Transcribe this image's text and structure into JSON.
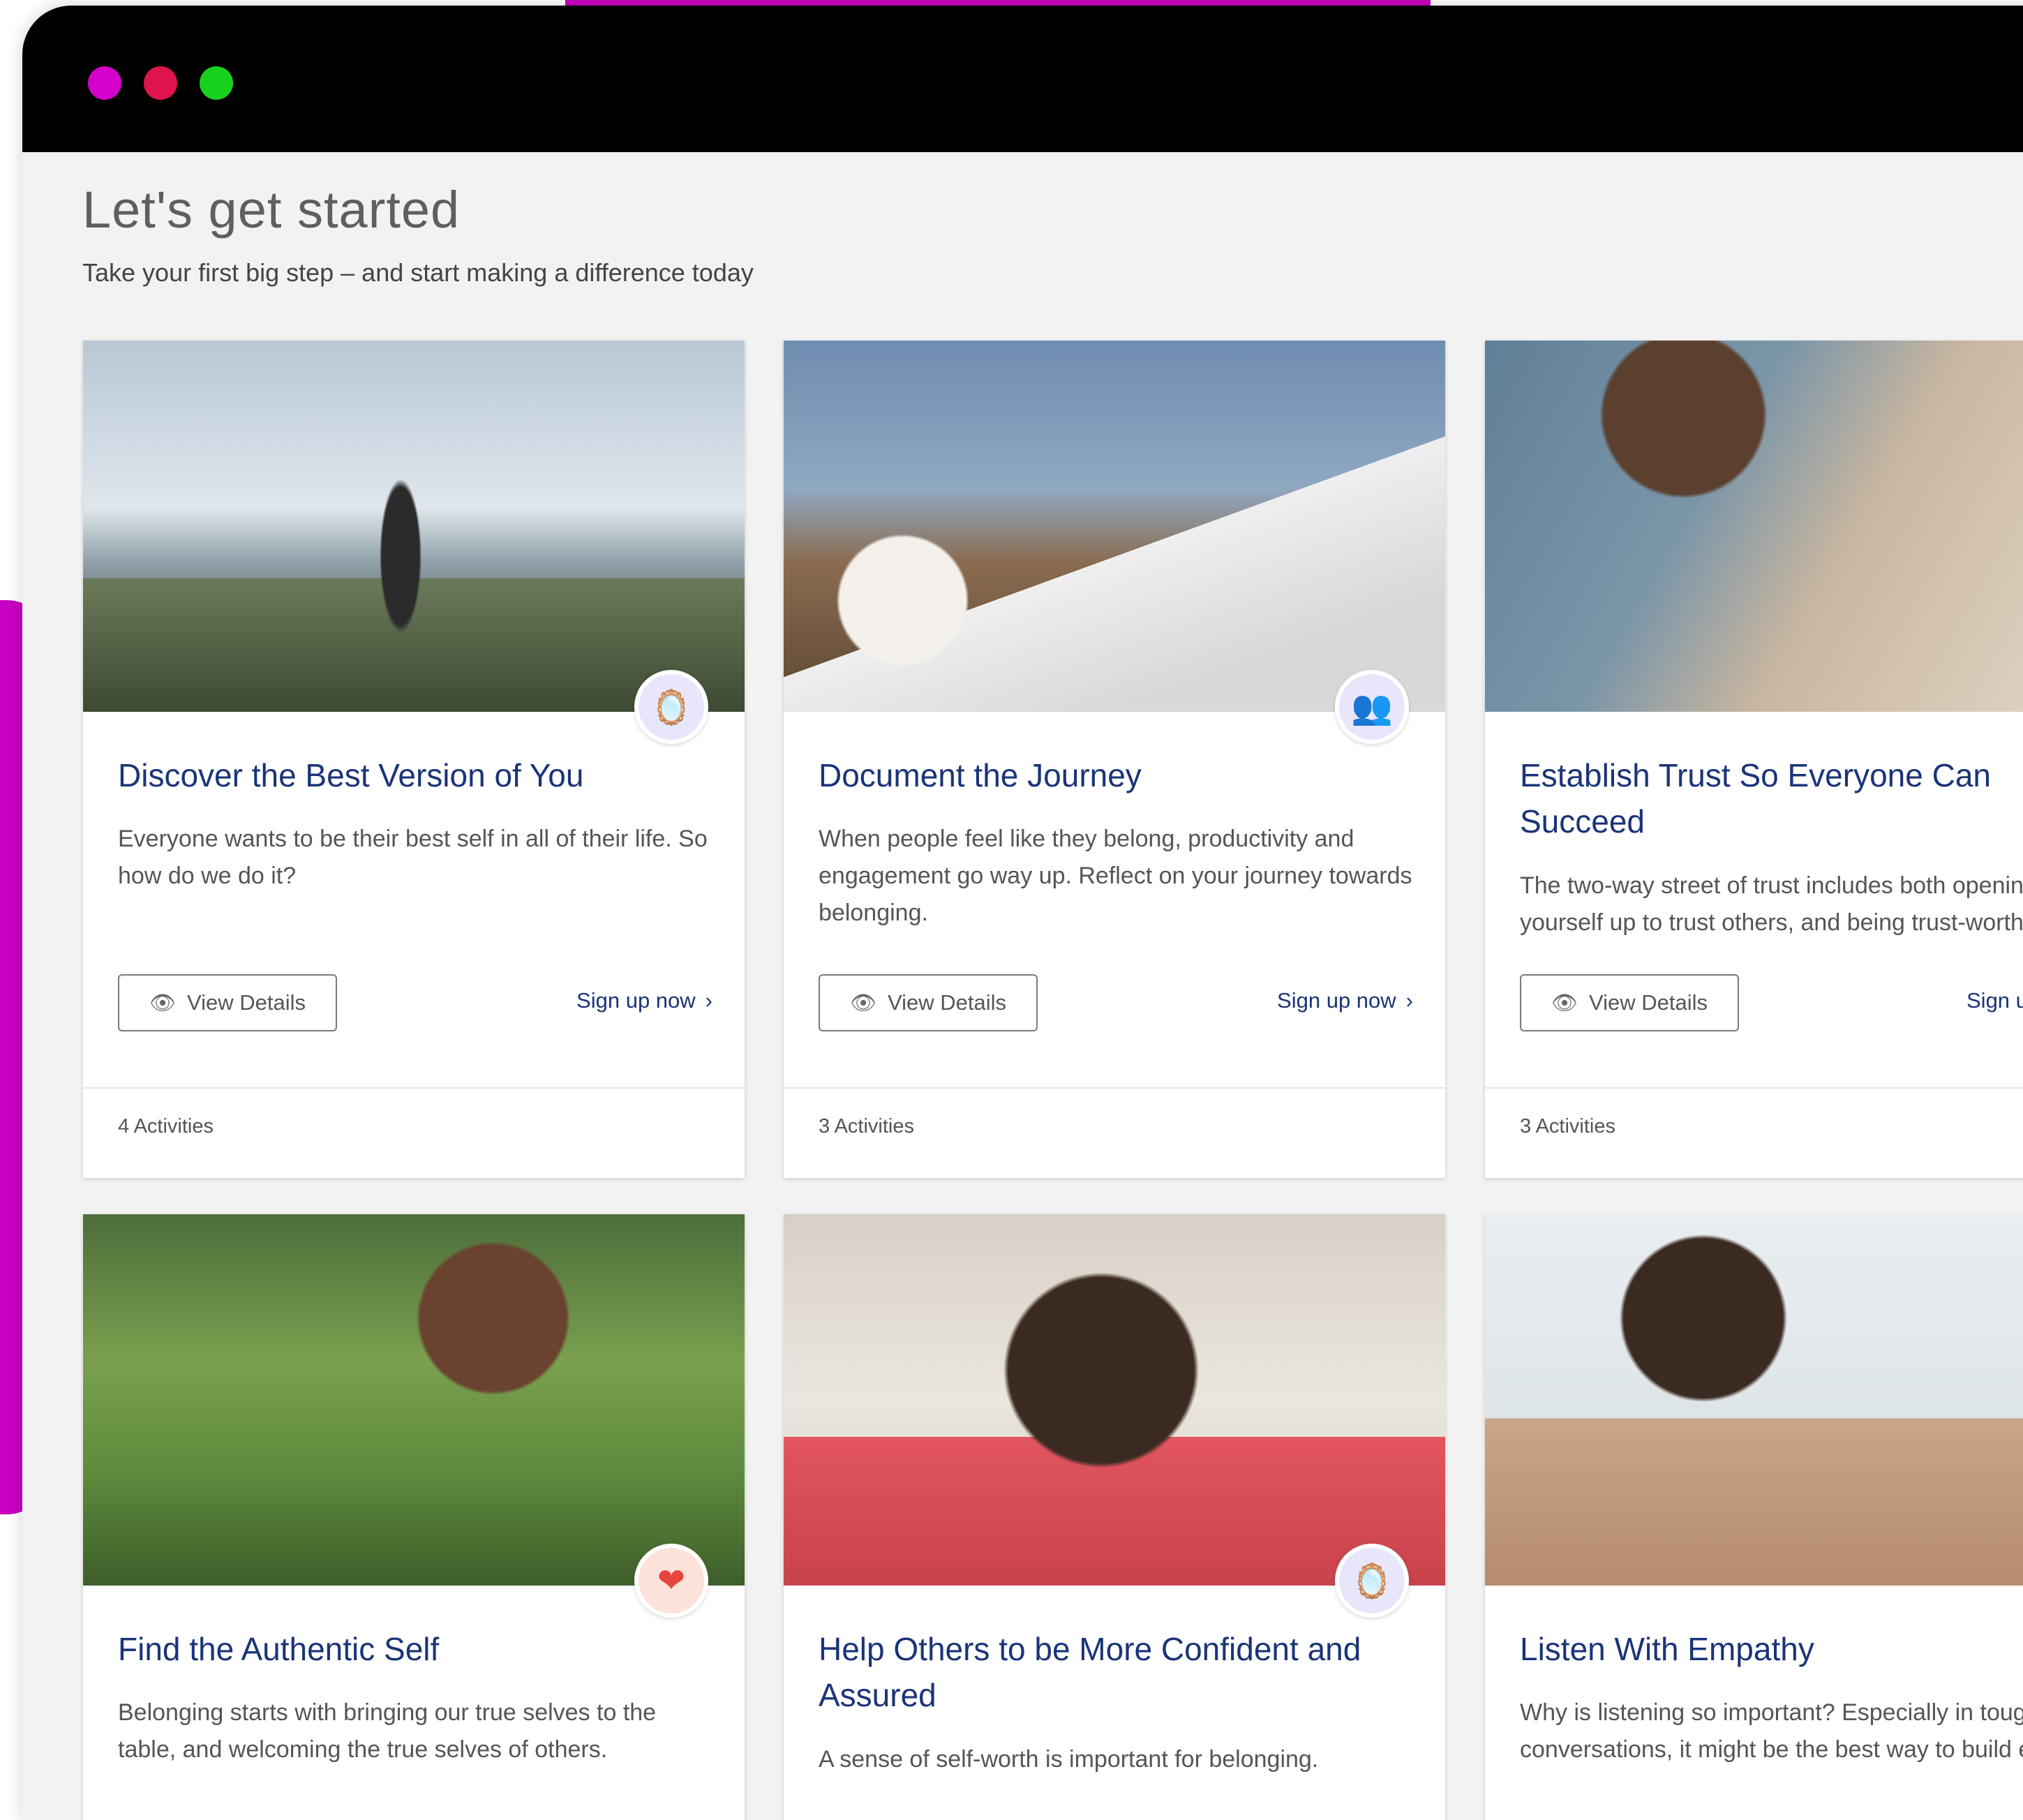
{
  "window": {
    "controls": [
      {
        "name": "close",
        "color": "#d400cc"
      },
      {
        "name": "minimize",
        "color": "#e0144c"
      },
      {
        "name": "maximize",
        "color": "#18d21e"
      }
    ]
  },
  "header": {
    "title": "Let's get started",
    "subtitle": "Take your first big step – and start making a difference today"
  },
  "colors": {
    "accent": "#c800c0",
    "title_blue": "#1a3478",
    "badge_lavender": "#e8e6fb",
    "badge_peach": "#fde2dc"
  },
  "cards": [
    {
      "title": "Discover the Best Version of You",
      "description": "Everyone wants to be their best self in all of their life. So how do we do it?",
      "badge_icon": "mirror-icon",
      "details_label": "View Details",
      "signup_label": "Sign up now",
      "activities": "4 Activities"
    },
    {
      "title": "Document the Journey",
      "description": "When people feel like they belong, productivity and engagement go way up. Reflect on your journey towards belonging.",
      "badge_icon": "people-icon",
      "details_label": "View Details",
      "signup_label": "Sign up now",
      "activities": "3 Activities"
    },
    {
      "title": "Establish Trust So Everyone Can Succeed",
      "description": "The two-way street of trust includes both opening yourself up to trust others, and being trust-worthy.",
      "details_label": "View Details",
      "signup_label": "Sign up now",
      "activities": "3 Activities"
    },
    {
      "title": "Find the Authentic Self",
      "description": "Belonging starts with bringing our true selves to the table, and welcoming the true selves of others.",
      "badge_icon": "heart-icon"
    },
    {
      "title": "Help Others to be More Confident and Assured",
      "description": "A sense of self-worth is important for belonging.",
      "badge_icon": "mirror-icon"
    },
    {
      "title": "Listen With Empathy",
      "description": "Why is listening so important? Especially in tough conversations, it might be the best way to build empathy."
    }
  ]
}
